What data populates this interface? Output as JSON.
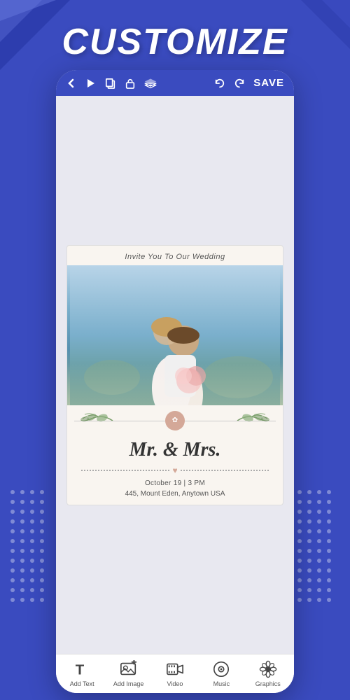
{
  "app": {
    "title": "CUSTOMIZE",
    "background_color": "#3a4bbf"
  },
  "toolbar": {
    "back_label": "‹",
    "play_label": "▶",
    "copy_label": "⧉",
    "lock_label": "🔓",
    "layers_label": "❖",
    "undo_label": "↩",
    "redo_label": "↪",
    "save_label": "SAVE"
  },
  "card": {
    "header_text": "Invite You To Our Wedding",
    "names_text": "Mr. & Mrs.",
    "date_text": "October 19 | 3 PM",
    "address_text": "445, Mount Eden, Anytown USA"
  },
  "bottom_toolbar": {
    "tools": [
      {
        "id": "add-text",
        "label": "Add Text",
        "icon": "T"
      },
      {
        "id": "add-image",
        "label": "Add Image",
        "icon": "IMG"
      },
      {
        "id": "video",
        "label": "Video",
        "icon": "VID"
      },
      {
        "id": "music",
        "label": "Music",
        "icon": "MUS"
      },
      {
        "id": "graphics",
        "label": "Graphics",
        "icon": "GFX"
      }
    ]
  }
}
